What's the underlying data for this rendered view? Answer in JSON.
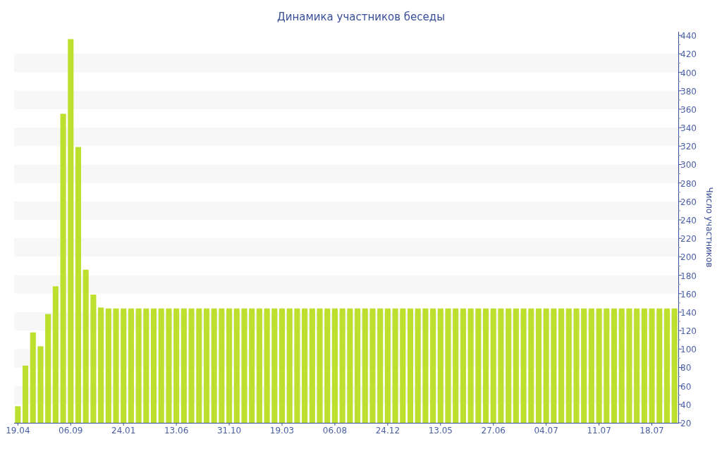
{
  "chart_data": {
    "type": "bar",
    "title": "Динамика участников беседы",
    "ylabel": "Число участников",
    "categories": [
      "19.04",
      null,
      null,
      null,
      null,
      null,
      null,
      "06.09",
      null,
      null,
      null,
      null,
      null,
      null,
      "24.01",
      null,
      null,
      null,
      null,
      null,
      null,
      "13.06",
      null,
      null,
      null,
      null,
      null,
      null,
      "31.10",
      null,
      null,
      null,
      null,
      null,
      null,
      "19.03",
      null,
      null,
      null,
      null,
      null,
      null,
      "06.08",
      null,
      null,
      null,
      null,
      null,
      null,
      "24.12",
      null,
      null,
      null,
      null,
      null,
      null,
      "13.05",
      null,
      null,
      null,
      null,
      null,
      null,
      "27.06",
      null,
      null,
      null,
      null,
      null,
      null,
      "04.07",
      null,
      null,
      null,
      null,
      null,
      null,
      "11.07",
      null,
      null,
      null,
      null,
      null,
      null,
      "18.07",
      null,
      null,
      null
    ],
    "values": [
      38,
      82,
      118,
      103,
      138,
      168,
      355,
      436,
      319,
      186,
      159,
      145,
      144,
      144,
      144,
      144,
      144,
      144,
      144,
      144,
      144,
      144,
      144,
      144,
      144,
      144,
      144,
      144,
      144,
      144,
      144,
      144,
      144,
      144,
      144,
      144,
      144,
      144,
      144,
      144,
      144,
      144,
      144,
      144,
      144,
      144,
      144,
      144,
      144,
      144,
      144,
      144,
      144,
      144,
      144,
      144,
      144,
      144,
      144,
      144,
      144,
      144,
      144,
      144,
      144,
      144,
      144,
      144,
      144,
      144,
      144,
      144,
      144,
      144,
      144,
      144,
      144,
      144,
      144,
      144,
      144,
      144,
      144,
      144,
      144,
      144,
      144,
      144
    ],
    "yticks": [
      20,
      40,
      60,
      80,
      100,
      120,
      140,
      160,
      180,
      200,
      220,
      240,
      260,
      280,
      300,
      320,
      340,
      360,
      380,
      400,
      420,
      440
    ],
    "ylim": [
      20,
      444
    ]
  }
}
